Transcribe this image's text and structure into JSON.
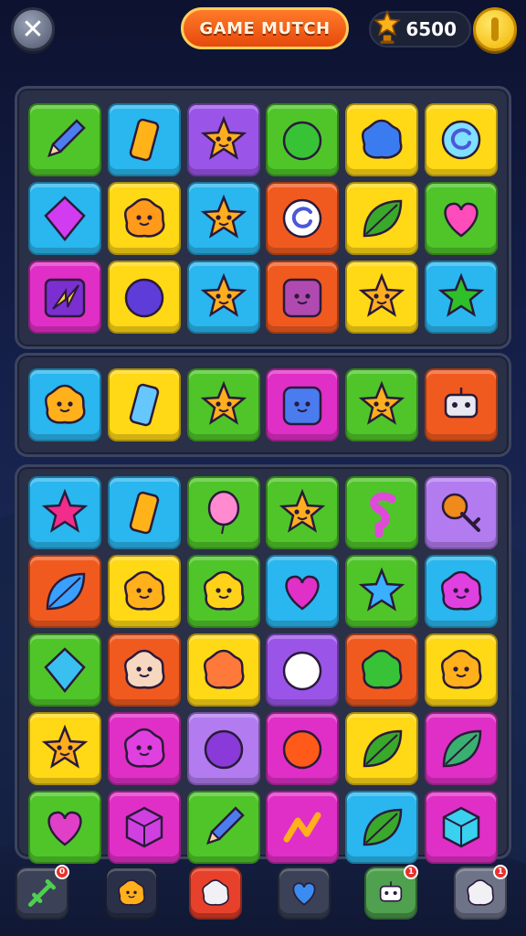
{
  "header": {
    "title": "GAME MUTCH",
    "score": "6500",
    "close_icon": "close-icon",
    "score_icon": "trophy-star-icon",
    "coin_icon": "coin-icon"
  },
  "colors": {
    "green": "#4fc52a",
    "blue": "#2ab6ee",
    "purple": "#9a55e8",
    "yellow": "#ffd816",
    "orange": "#f15a1f",
    "magenta": "#e02fc6",
    "pink": "#f53a8c",
    "violet": "#b27cf0"
  },
  "board_top": [
    {
      "icon": "pencil-icon",
      "bg": "green"
    },
    {
      "icon": "gem-bar-icon",
      "bg": "blue"
    },
    {
      "icon": "star-face-icon",
      "bg": "purple"
    },
    {
      "icon": "apple-icon",
      "bg": "green"
    },
    {
      "icon": "octopus-icon",
      "bg": "yellow"
    },
    {
      "icon": "spiral-flower-icon",
      "bg": "yellow"
    },
    {
      "icon": "diamond-gem-icon",
      "bg": "blue"
    },
    {
      "icon": "cookie-face-icon",
      "bg": "yellow"
    },
    {
      "icon": "star-face-icon",
      "bg": "blue"
    },
    {
      "icon": "swirl-icon",
      "bg": "orange"
    },
    {
      "icon": "leaf-icon",
      "bg": "yellow"
    },
    {
      "icon": "heart-icon",
      "bg": "green"
    },
    {
      "icon": "lightning-icon",
      "bg": "magenta"
    },
    {
      "icon": "planet-icon",
      "bg": "yellow"
    },
    {
      "icon": "star-face-icon",
      "bg": "blue"
    },
    {
      "icon": "bag-face-icon",
      "bg": "orange"
    },
    {
      "icon": "star-face-icon",
      "bg": "yellow"
    },
    {
      "icon": "pin-star-icon",
      "bg": "blue"
    }
  ],
  "board_middle": [
    {
      "icon": "sun-face-icon",
      "bg": "blue"
    },
    {
      "icon": "ice-pop-icon",
      "bg": "yellow"
    },
    {
      "icon": "star-face-icon",
      "bg": "green"
    },
    {
      "icon": "box-face-icon",
      "bg": "magenta"
    },
    {
      "icon": "star-face-icon",
      "bg": "green"
    },
    {
      "icon": "robot-icon",
      "bg": "orange"
    }
  ],
  "board_bottom": [
    {
      "icon": "star-outline-icon",
      "bg": "blue"
    },
    {
      "icon": "gem-bar-icon",
      "bg": "blue"
    },
    {
      "icon": "balloon-icon",
      "bg": "green"
    },
    {
      "icon": "star-face-icon",
      "bg": "green"
    },
    {
      "icon": "squiggle-icon",
      "bg": "green"
    },
    {
      "icon": "key-icon",
      "bg": "violet"
    },
    {
      "icon": "feather-icon",
      "bg": "orange"
    },
    {
      "icon": "sun-face-icon",
      "bg": "yellow"
    },
    {
      "icon": "cat-face-icon",
      "bg": "green"
    },
    {
      "icon": "heart-planet-icon",
      "bg": "blue"
    },
    {
      "icon": "star-icon",
      "bg": "green"
    },
    {
      "icon": "blob-face-icon",
      "bg": "blue"
    },
    {
      "icon": "shield-gem-icon",
      "bg": "green"
    },
    {
      "icon": "ghost-face-icon",
      "bg": "orange"
    },
    {
      "icon": "flower-icon",
      "bg": "yellow"
    },
    {
      "icon": "sword-icon",
      "bg": "purple"
    },
    {
      "icon": "slime-icon",
      "bg": "orange"
    },
    {
      "icon": "sun-face-icon",
      "bg": "yellow"
    },
    {
      "icon": "star-face-icon",
      "bg": "yellow"
    },
    {
      "icon": "blob-face-icon",
      "bg": "magenta"
    },
    {
      "icon": "potion-icon",
      "bg": "violet"
    },
    {
      "icon": "lollipop-icon",
      "bg": "magenta"
    },
    {
      "icon": "leaf-icon",
      "bg": "yellow"
    },
    {
      "icon": "feather-leaf-icon",
      "bg": "magenta"
    },
    {
      "icon": "mushroom-icon",
      "bg": "green"
    },
    {
      "icon": "cube-icon",
      "bg": "magenta"
    },
    {
      "icon": "pencil-icon",
      "bg": "green"
    },
    {
      "icon": "note-icon",
      "bg": "magenta"
    },
    {
      "icon": "leaf-icon",
      "bg": "blue"
    },
    {
      "icon": "color-cube-icon",
      "bg": "magenta"
    }
  ],
  "bottom_bar": [
    {
      "icon": "arrow-up-icon",
      "bg": "#3b4257",
      "badge": "0"
    },
    {
      "icon": "sun-face-icon",
      "bg": "#2a3048",
      "badge": ""
    },
    {
      "icon": "gear-icon",
      "bg": "#e8412b",
      "badge": ""
    },
    {
      "icon": "check-icon",
      "bg": "#3b4257",
      "badge": ""
    },
    {
      "icon": "camera-icon",
      "bg": "#4fa04f",
      "badge": "1"
    },
    {
      "icon": "gear-icon",
      "bg": "#6e7388",
      "badge": "1"
    }
  ]
}
